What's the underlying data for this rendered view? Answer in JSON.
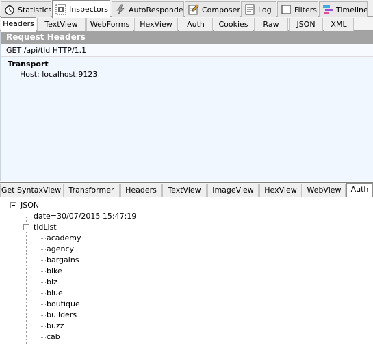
{
  "top_tabs": [
    {
      "label": "Statistics",
      "icon": "stopwatch-icon"
    },
    {
      "label": "Inspectors",
      "icon": "inspector-icon"
    },
    {
      "label": "AutoResponder",
      "icon": "lightning-icon"
    },
    {
      "label": "Composer",
      "icon": "pencil-icon"
    },
    {
      "label": "Log",
      "icon": "log-icon"
    },
    {
      "label": "Filters",
      "icon": "checkbox-icon"
    },
    {
      "label": "Timeline",
      "icon": "timeline-icon"
    }
  ],
  "request_tabs": [
    "Headers",
    "TextView",
    "WebForms",
    "HexView",
    "Auth",
    "Cookies",
    "Raw",
    "JSON",
    "XML"
  ],
  "request": {
    "title": "Request Headers",
    "request_line": "GET /api/tld HTTP/1.1",
    "section": "Transport",
    "host": "Host: localhost:9123"
  },
  "response_tabs": [
    "Get SyntaxView",
    "Transformer",
    "Headers",
    "TextView",
    "ImageView",
    "HexView",
    "WebView",
    "Auth"
  ],
  "tree": {
    "root": "JSON",
    "date": "date=30/07/2015 15:47:19",
    "list_name": "tldList",
    "items": [
      "academy",
      "agency",
      "bargains",
      "bike",
      "biz",
      "blue",
      "boutique",
      "builders",
      "buzz",
      "cab"
    ]
  },
  "colors": {
    "header_bar": "#a3a3a3",
    "panel_bg": "#f0f7ff",
    "tab_bg": "#f0f0f0"
  }
}
